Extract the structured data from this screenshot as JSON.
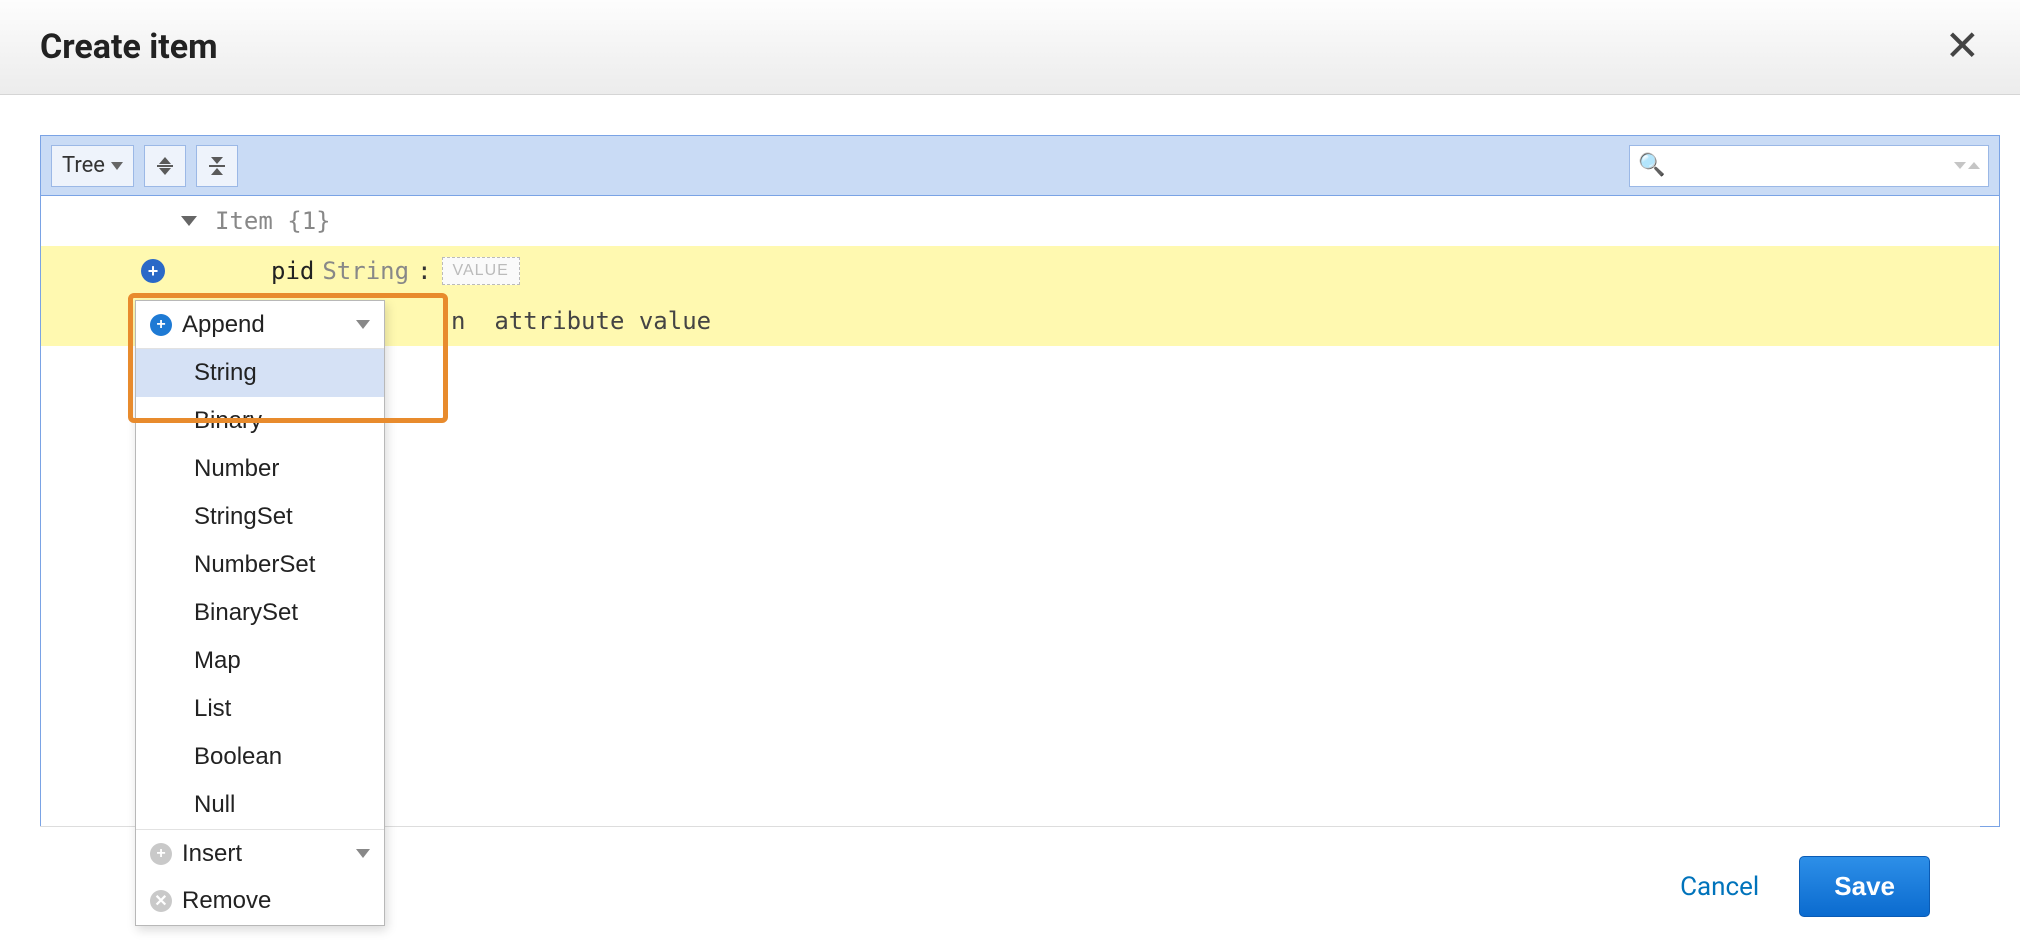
{
  "dialog": {
    "title": "Create item"
  },
  "toolbar": {
    "view_mode": "Tree",
    "search_placeholder": ""
  },
  "tree": {
    "root_label": "Item",
    "root_count": "{1}",
    "row": {
      "name": "pid",
      "type": "String",
      "value_placeholder": "VALUE"
    },
    "hint_suffix": "attribute value",
    "hint_visible_fragment": "n"
  },
  "context_menu": {
    "append": "Append",
    "insert": "Insert",
    "remove": "Remove",
    "types": [
      "String",
      "Binary",
      "Number",
      "StringSet",
      "NumberSet",
      "BinarySet",
      "Map",
      "List",
      "Boolean",
      "Null"
    ],
    "selected_type_index": 0
  },
  "footer": {
    "cancel": "Cancel",
    "save": "Save"
  }
}
